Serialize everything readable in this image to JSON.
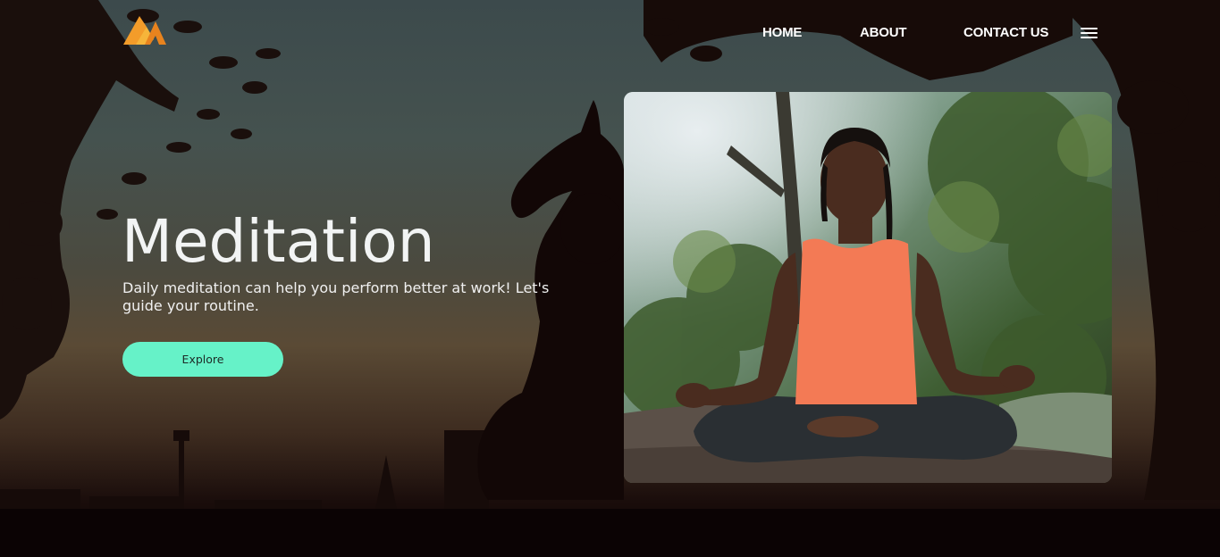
{
  "nav": {
    "logo_icon": "mountain-m-logo-icon",
    "links": [
      "HOME",
      "ABOUT",
      "CONTACT US"
    ],
    "menu_icon": "hamburger-menu-icon"
  },
  "hero": {
    "title": "Meditation",
    "subtitle": "Daily meditation can help you perform better at work! Let's guide your routine.",
    "cta_label": "Explore"
  },
  "colors": {
    "accent": "#66f2c8",
    "logo_orange": "#f39c2a",
    "nav_text": "#ffffff",
    "top_color": "#f37a55"
  }
}
